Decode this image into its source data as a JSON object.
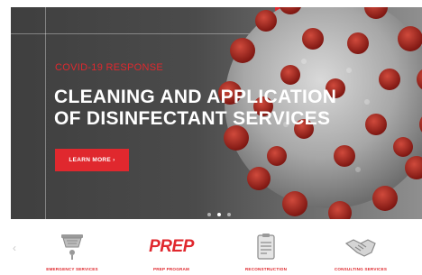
{
  "hero": {
    "eyebrow": "COVID-19 RESPONSE",
    "headline_line1": "CLEANING AND APPLICATION",
    "headline_line2": "OF DISINFECTANT SERVICES",
    "cta_label": "LEARN MORE ›",
    "slides": {
      "count": 3,
      "active_index": 1
    }
  },
  "services": [
    {
      "label": "EMERGENCY SERVICES",
      "icon": "smoke-detector-icon"
    },
    {
      "label": "PREP PROGRAM",
      "logo": "PREP"
    },
    {
      "label": "RECONSTRUCTION",
      "icon": "clipboard-document-icon"
    },
    {
      "label": "CONSULTING SERVICES",
      "icon": "handshake-icon"
    }
  ],
  "carousel_prev_glyph": "‹",
  "colors": {
    "accent": "#e0282e",
    "hero_bg": "#4b4b4b",
    "text_light": "#ffffff"
  }
}
